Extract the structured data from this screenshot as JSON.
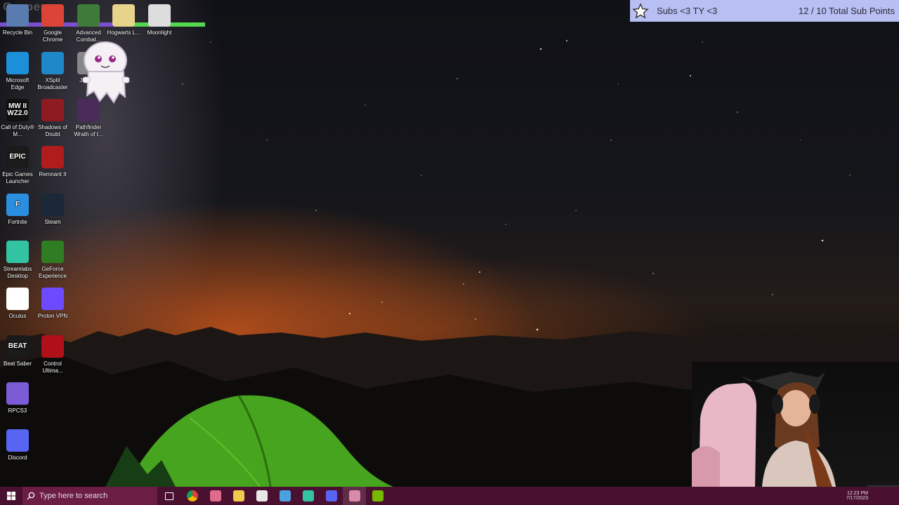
{
  "overlay": {
    "streamer_name": "Casper",
    "goal_bar": {
      "purple_fraction": 0.6,
      "green_fraction": 0.4
    },
    "sub_goal": {
      "title": "Subs <3 TY <3",
      "current": "12",
      "target_text": "/ 10 Total Sub Points",
      "icon": "star-icon"
    }
  },
  "desktop": {
    "icons": [
      {
        "name": "recycle-bin",
        "label": "Recycle Bin",
        "color": "#5a7bb0",
        "glyph": ""
      },
      {
        "name": "google-chrome",
        "label": "Google Chrome",
        "color": "#db4437",
        "glyph": ""
      },
      {
        "name": "advanced-combat",
        "label": "Advanced Combat...",
        "color": "#3f7a3a",
        "glyph": ""
      },
      {
        "name": "hogwarts-legacy",
        "label": "Hogwarts L...",
        "color": "#e8d38a",
        "glyph": ""
      },
      {
        "name": "moonlight",
        "label": "Moonlight",
        "color": "#dddddd",
        "glyph": ""
      },
      {
        "name": "microsoft-edge",
        "label": "Microsoft Edge",
        "color": "#1d8fd8",
        "glyph": ""
      },
      {
        "name": "xsplit-broadcaster",
        "label": "XSplit Broadcaster",
        "color": "#1e88c8",
        "glyph": ""
      },
      {
        "name": "johnny",
        "label": "Johnny",
        "color": "#888888",
        "glyph": ""
      },
      {
        "name": "call-of-duty",
        "label": "Call of Duty® M...",
        "color": "#111111",
        "glyph": "MW II WZ2.0"
      },
      {
        "name": "shadows-of-doubt",
        "label": "Shadows of Doubt",
        "color": "#8e1b22",
        "glyph": ""
      },
      {
        "name": "pathfinder",
        "label": "Pathfinder Wrath of t...",
        "color": "#4a2b5a",
        "glyph": ""
      },
      {
        "name": "epic-games-launcher",
        "label": "Epic Games Launcher",
        "color": "#1b1b1b",
        "glyph": "EPIC"
      },
      {
        "name": "remnant-2",
        "label": "Remnant II",
        "color": "#b01c1c",
        "glyph": ""
      },
      {
        "name": "fortnite",
        "label": "Fortnite",
        "color": "#2a8fe0",
        "glyph": "F"
      },
      {
        "name": "steam",
        "label": "Steam",
        "color": "#1b2838",
        "glyph": ""
      },
      {
        "name": "streamlabs-desktop",
        "label": "Streamlabs Desktop",
        "color": "#31c3a2",
        "glyph": ""
      },
      {
        "name": "geforce-experience",
        "label": "GeForce Experience",
        "color": "#2f7d22",
        "glyph": ""
      },
      {
        "name": "oculus",
        "label": "Oculus",
        "color": "#ffffff",
        "glyph": ""
      },
      {
        "name": "proton-vpn",
        "label": "Proton VPN",
        "color": "#6d4aff",
        "glyph": ""
      },
      {
        "name": "beat-saber",
        "label": "Beat Saber",
        "color": "#1a1a1a",
        "glyph": "BEAT"
      },
      {
        "name": "control-ultimate",
        "label": "Control Ultima...",
        "color": "#b0101a",
        "glyph": ""
      },
      {
        "name": "rpcs3",
        "label": "RPCS3",
        "color": "#7b5bd6",
        "glyph": ""
      },
      {
        "name": "discord",
        "label": "Discord",
        "color": "#5865f2",
        "glyph": ""
      }
    ]
  },
  "taskbar": {
    "search_placeholder": "Type here to search",
    "apps": [
      {
        "name": "task-view",
        "color": "#ffffff"
      },
      {
        "name": "chrome",
        "color": "#db4437"
      },
      {
        "name": "paint-app",
        "color": "#e06a8a"
      },
      {
        "name": "file-explorer",
        "color": "#f2c94c"
      },
      {
        "name": "store",
        "color": "#e8e8e8"
      },
      {
        "name": "steam",
        "color": "#4aa3e0"
      },
      {
        "name": "streamlabs",
        "color": "#31c3a2"
      },
      {
        "name": "discord",
        "color": "#5865f2"
      },
      {
        "name": "active-app",
        "color": "#d98aa8"
      },
      {
        "name": "nvidia",
        "color": "#76b900"
      }
    ],
    "clock_time": "12:23 PM",
    "clock_date": "7/17/2023"
  }
}
